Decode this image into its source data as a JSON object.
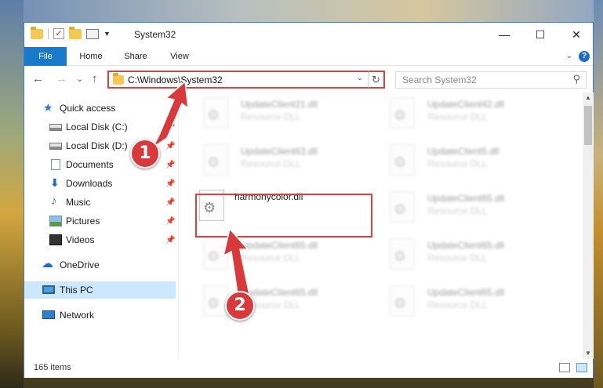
{
  "window": {
    "title": "System32",
    "minimize": "—",
    "maximize": "☐",
    "close": "✕"
  },
  "ribbon": {
    "tabs": [
      "File",
      "Home",
      "Share",
      "View"
    ],
    "collapse_glyph": "⌄",
    "help_glyph": "?"
  },
  "nav": {
    "back": "←",
    "forward": "→",
    "recent": "⌄",
    "up": "↑",
    "address": "C:\\Windows\\System32",
    "address_dropdown": "⌄",
    "refresh": "↻",
    "search_placeholder": "Search System32",
    "search_glyph": "⚲"
  },
  "sidebar": {
    "items": [
      {
        "label": "Quick access",
        "icon": "star-icon",
        "pinned": false
      },
      {
        "label": "Local Disk (C:)",
        "icon": "drive-icon",
        "pinned": true
      },
      {
        "label": "Local Disk (D:)",
        "icon": "drive-icon",
        "pinned": true
      },
      {
        "label": "Documents",
        "icon": "document-icon",
        "pinned": true
      },
      {
        "label": "Downloads",
        "icon": "download-icon",
        "pinned": true
      },
      {
        "label": "Music",
        "icon": "music-icon",
        "pinned": true
      },
      {
        "label": "Pictures",
        "icon": "pictures-icon",
        "pinned": true
      },
      {
        "label": "Videos",
        "icon": "videos-icon",
        "pinned": true
      },
      {
        "label": "OneDrive",
        "icon": "onedrive-icon",
        "pinned": false
      },
      {
        "label": "This PC",
        "icon": "this-pc-icon",
        "pinned": false,
        "selected": true
      },
      {
        "label": "Network",
        "icon": "network-icon",
        "pinned": false
      }
    ],
    "pin_glyph": "📌"
  },
  "files": [
    {
      "name": "UpdateClient21.dll",
      "type": "Resource DLL",
      "blurred": true
    },
    {
      "name": "UpdateClient42.dll",
      "type": "Resource DLL",
      "blurred": true
    },
    {
      "name": "UpdateClient63.dll",
      "type": "Resource DLL",
      "blurred": true
    },
    {
      "name": "UpdateClient5.dll",
      "type": "Resource DLL",
      "blurred": true
    },
    {
      "name": "harmonycolor.dll",
      "type": "",
      "blurred": false
    },
    {
      "name": "UpdateClient65.dll",
      "type": "Resource DLL",
      "blurred": true
    },
    {
      "name": "UpdateClient65.dll",
      "type": "Resource DLL",
      "blurred": true
    },
    {
      "name": "UpdateClient65.dll",
      "type": "Resource DLL",
      "blurred": true
    },
    {
      "name": "UpdateClient65.dll",
      "type": "Resource DLL",
      "blurred": true
    },
    {
      "name": "UpdateClient65.dll",
      "type": "Resource DLL",
      "blurred": true
    }
  ],
  "status": {
    "item_count": "165 items"
  },
  "annotations": {
    "step1": "1",
    "step2": "2",
    "highlight_color": "#d94141"
  },
  "colors": {
    "accent": "#1979ca",
    "selected": "#cce8ff"
  }
}
